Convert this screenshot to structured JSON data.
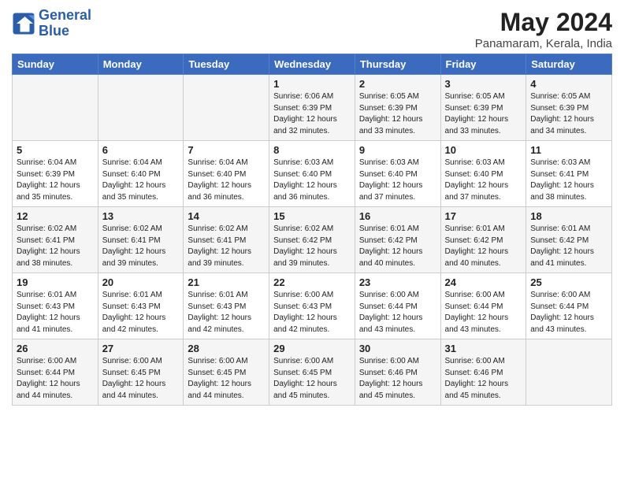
{
  "logo": {
    "line1": "General",
    "line2": "Blue"
  },
  "title": "May 2024",
  "location": "Panamaram, Kerala, India",
  "days_of_week": [
    "Sunday",
    "Monday",
    "Tuesday",
    "Wednesday",
    "Thursday",
    "Friday",
    "Saturday"
  ],
  "weeks": [
    [
      {
        "day": "",
        "info": ""
      },
      {
        "day": "",
        "info": ""
      },
      {
        "day": "",
        "info": ""
      },
      {
        "day": "1",
        "info": "Sunrise: 6:06 AM\nSunset: 6:39 PM\nDaylight: 12 hours\nand 32 minutes."
      },
      {
        "day": "2",
        "info": "Sunrise: 6:05 AM\nSunset: 6:39 PM\nDaylight: 12 hours\nand 33 minutes."
      },
      {
        "day": "3",
        "info": "Sunrise: 6:05 AM\nSunset: 6:39 PM\nDaylight: 12 hours\nand 33 minutes."
      },
      {
        "day": "4",
        "info": "Sunrise: 6:05 AM\nSunset: 6:39 PM\nDaylight: 12 hours\nand 34 minutes."
      }
    ],
    [
      {
        "day": "5",
        "info": "Sunrise: 6:04 AM\nSunset: 6:39 PM\nDaylight: 12 hours\nand 35 minutes."
      },
      {
        "day": "6",
        "info": "Sunrise: 6:04 AM\nSunset: 6:40 PM\nDaylight: 12 hours\nand 35 minutes."
      },
      {
        "day": "7",
        "info": "Sunrise: 6:04 AM\nSunset: 6:40 PM\nDaylight: 12 hours\nand 36 minutes."
      },
      {
        "day": "8",
        "info": "Sunrise: 6:03 AM\nSunset: 6:40 PM\nDaylight: 12 hours\nand 36 minutes."
      },
      {
        "day": "9",
        "info": "Sunrise: 6:03 AM\nSunset: 6:40 PM\nDaylight: 12 hours\nand 37 minutes."
      },
      {
        "day": "10",
        "info": "Sunrise: 6:03 AM\nSunset: 6:40 PM\nDaylight: 12 hours\nand 37 minutes."
      },
      {
        "day": "11",
        "info": "Sunrise: 6:03 AM\nSunset: 6:41 PM\nDaylight: 12 hours\nand 38 minutes."
      }
    ],
    [
      {
        "day": "12",
        "info": "Sunrise: 6:02 AM\nSunset: 6:41 PM\nDaylight: 12 hours\nand 38 minutes."
      },
      {
        "day": "13",
        "info": "Sunrise: 6:02 AM\nSunset: 6:41 PM\nDaylight: 12 hours\nand 39 minutes."
      },
      {
        "day": "14",
        "info": "Sunrise: 6:02 AM\nSunset: 6:41 PM\nDaylight: 12 hours\nand 39 minutes."
      },
      {
        "day": "15",
        "info": "Sunrise: 6:02 AM\nSunset: 6:42 PM\nDaylight: 12 hours\nand 39 minutes."
      },
      {
        "day": "16",
        "info": "Sunrise: 6:01 AM\nSunset: 6:42 PM\nDaylight: 12 hours\nand 40 minutes."
      },
      {
        "day": "17",
        "info": "Sunrise: 6:01 AM\nSunset: 6:42 PM\nDaylight: 12 hours\nand 40 minutes."
      },
      {
        "day": "18",
        "info": "Sunrise: 6:01 AM\nSunset: 6:42 PM\nDaylight: 12 hours\nand 41 minutes."
      }
    ],
    [
      {
        "day": "19",
        "info": "Sunrise: 6:01 AM\nSunset: 6:43 PM\nDaylight: 12 hours\nand 41 minutes."
      },
      {
        "day": "20",
        "info": "Sunrise: 6:01 AM\nSunset: 6:43 PM\nDaylight: 12 hours\nand 42 minutes."
      },
      {
        "day": "21",
        "info": "Sunrise: 6:01 AM\nSunset: 6:43 PM\nDaylight: 12 hours\nand 42 minutes."
      },
      {
        "day": "22",
        "info": "Sunrise: 6:00 AM\nSunset: 6:43 PM\nDaylight: 12 hours\nand 42 minutes."
      },
      {
        "day": "23",
        "info": "Sunrise: 6:00 AM\nSunset: 6:44 PM\nDaylight: 12 hours\nand 43 minutes."
      },
      {
        "day": "24",
        "info": "Sunrise: 6:00 AM\nSunset: 6:44 PM\nDaylight: 12 hours\nand 43 minutes."
      },
      {
        "day": "25",
        "info": "Sunrise: 6:00 AM\nSunset: 6:44 PM\nDaylight: 12 hours\nand 43 minutes."
      }
    ],
    [
      {
        "day": "26",
        "info": "Sunrise: 6:00 AM\nSunset: 6:44 PM\nDaylight: 12 hours\nand 44 minutes."
      },
      {
        "day": "27",
        "info": "Sunrise: 6:00 AM\nSunset: 6:45 PM\nDaylight: 12 hours\nand 44 minutes."
      },
      {
        "day": "28",
        "info": "Sunrise: 6:00 AM\nSunset: 6:45 PM\nDaylight: 12 hours\nand 44 minutes."
      },
      {
        "day": "29",
        "info": "Sunrise: 6:00 AM\nSunset: 6:45 PM\nDaylight: 12 hours\nand 45 minutes."
      },
      {
        "day": "30",
        "info": "Sunrise: 6:00 AM\nSunset: 6:46 PM\nDaylight: 12 hours\nand 45 minutes."
      },
      {
        "day": "31",
        "info": "Sunrise: 6:00 AM\nSunset: 6:46 PM\nDaylight: 12 hours\nand 45 minutes."
      },
      {
        "day": "",
        "info": ""
      }
    ]
  ]
}
